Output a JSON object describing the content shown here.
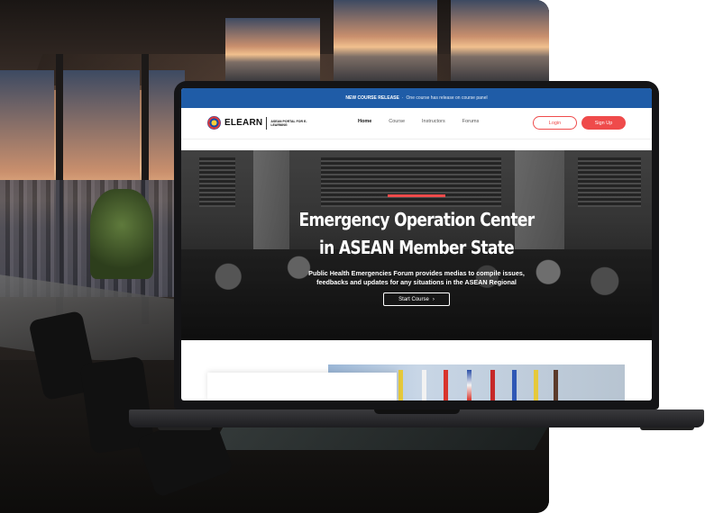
{
  "topbar": {
    "highlight": "NEW COURSE RELEASE",
    "separator": "·",
    "message": "One course has release on course panel"
  },
  "brand": {
    "name": "ELEARN",
    "tagline": "ASEAN PORTAL FOR E-LEARNING"
  },
  "nav": {
    "items": [
      {
        "label": "Home",
        "active": true
      },
      {
        "label": "Course",
        "active": false
      },
      {
        "label": "Instructors",
        "active": false
      },
      {
        "label": "Forums",
        "active": false
      }
    ],
    "login_label": "Login",
    "signup_label": "Sign Up"
  },
  "hero": {
    "title_line1": "Emergency Operation Center",
    "title_line2": "in ASEAN Member State",
    "description_line1": "Public Health Emergencies Forum provides medias to compile issues,",
    "description_line2": "feedbacks and updates for any situations in the ASEAN Regional",
    "cta_label": "Start Course",
    "cta_icon": "chevron-right-icon"
  },
  "colors": {
    "topbar_bg": "#1f5ca7",
    "accent": "#ef4b4b",
    "text_dark": "#111111"
  }
}
